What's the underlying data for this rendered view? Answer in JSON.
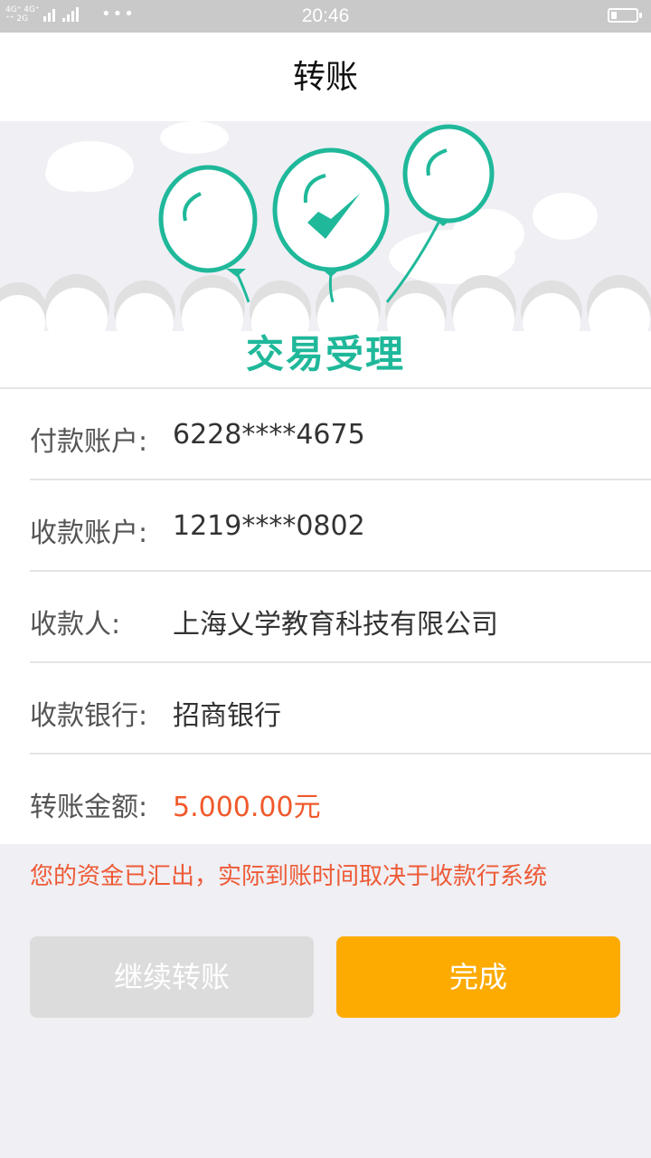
{
  "status_bar": {
    "network_top": "4G⁺ 4G⁺",
    "network_bottom": "⁺⁺ 2G",
    "network_2g": "2G",
    "dots": "•••",
    "time": "20:46"
  },
  "header": {
    "title": "转账"
  },
  "banner": {
    "title": "交易受理",
    "accent_color": "#1fb89a"
  },
  "details": [
    {
      "label": "付款账户:",
      "value": "6228****4675"
    },
    {
      "label": "收款账户:",
      "value": "1219****0802"
    },
    {
      "label": "收款人:",
      "value": "上海乂学教育科技有限公司"
    },
    {
      "label": "收款银行:",
      "value": "招商银行"
    },
    {
      "label": "转账金额:",
      "value": "5.000.00元"
    }
  ],
  "notice": "您的资金已汇出，实际到账时间取决于收款行系统",
  "buttons": {
    "continue_label": "继续转账",
    "done_label": "完成"
  },
  "colors": {
    "amount": "#f0592b",
    "notice": "#ee5a36",
    "done_button": "#fdab00",
    "continue_button": "#dcdcdc"
  }
}
